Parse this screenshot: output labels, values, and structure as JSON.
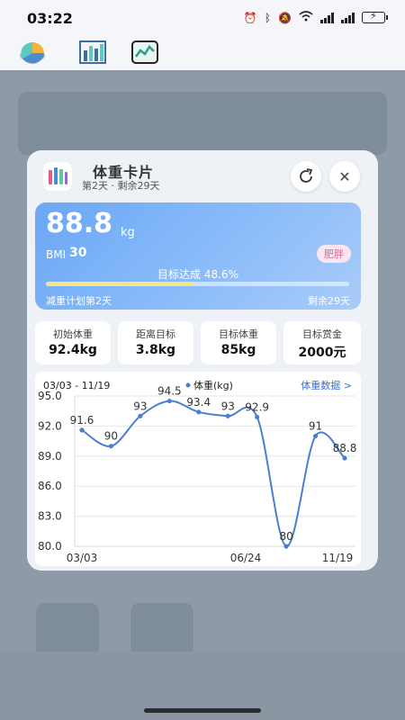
{
  "status_bar": {
    "time": "03:22",
    "battery_icon": "battery-charging-icon"
  },
  "top_icons": [
    "pie-chart-icon",
    "bar-chart-icon",
    "line-chart-icon"
  ],
  "card": {
    "title": "体重卡片",
    "subtitle": "第2天 · 剩余29天",
    "current_weight": "88.8",
    "weight_unit": "kg",
    "bmi_label": "BMI",
    "bmi_value": "30",
    "bmi_status": "肥胖",
    "progress_text": "目标达成 48.6%",
    "progress_value": 0.486,
    "plan_left": "减重计划第2天",
    "plan_right": "剩余29天",
    "stats": [
      {
        "label": "初始体重",
        "value": "92.4kg"
      },
      {
        "label": "距离目标",
        "value": "3.8kg"
      },
      {
        "label": "目标体重",
        "value": "85kg"
      },
      {
        "label": "目标赏金",
        "value": "2000元"
      }
    ],
    "chart_range": "03/03 - 11/19",
    "data_link": "体重数据 >",
    "accent_color": "#4a7fd0"
  },
  "chart_data": {
    "type": "line",
    "series": [
      {
        "name": "体重(kg)",
        "values": [
          91.6,
          90,
          93,
          94.5,
          93.4,
          93,
          92.9,
          80,
          91,
          88.8
        ]
      }
    ],
    "y_ticks": [
      "95.0",
      "92.0",
      "89.0",
      "86.0",
      "83.0",
      "80.0"
    ],
    "ylim": [
      80,
      95
    ],
    "x_ticks": [
      "03/03",
      "06/24",
      "11/19"
    ],
    "grid": "horizontal",
    "legend": "top-center"
  }
}
